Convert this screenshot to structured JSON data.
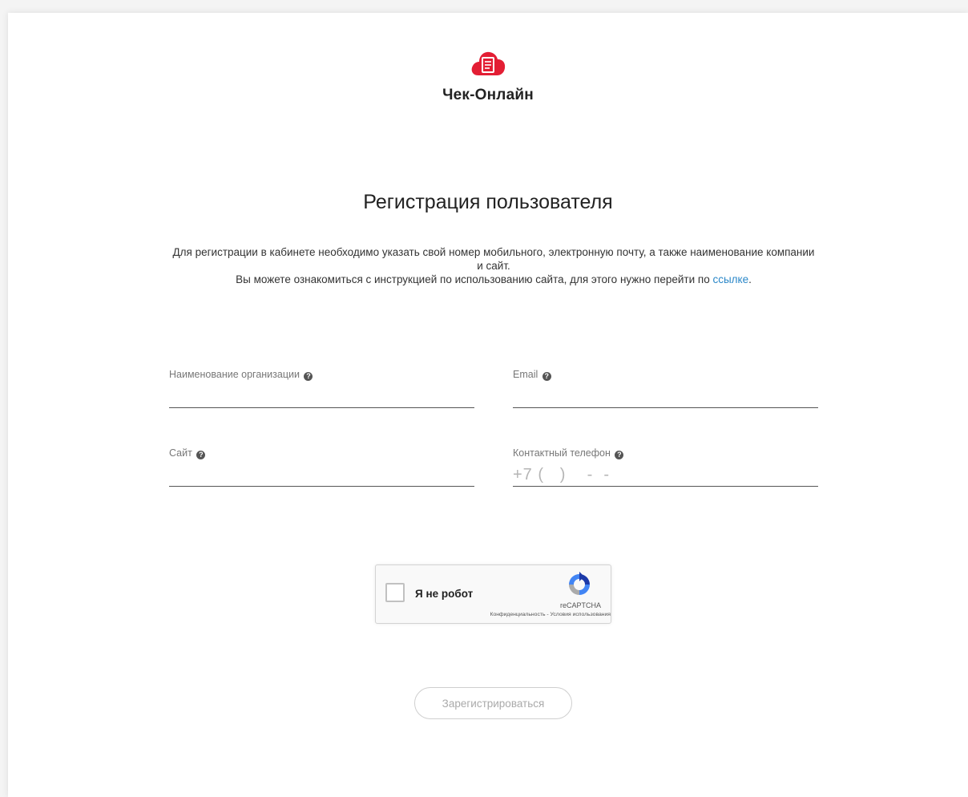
{
  "brand": {
    "name": "Чек-Онлайн",
    "color": "#e31e34"
  },
  "page": {
    "title": "Регистрация пользователя"
  },
  "intro": {
    "line1": "Для регистрации в кабинете необходимо указать свой номер мобильного, электронную почту, а также наименование компании и сайт.",
    "line2_prefix": "Вы можете ознакомиться с инструкцией по использованию сайта, для этого нужно перейти по ",
    "link_text": "ссылке",
    "line2_suffix": ".",
    "link_color": "#2a87c8"
  },
  "form": {
    "organization": {
      "label": "Наименование организации",
      "value": "",
      "placeholder": ""
    },
    "email": {
      "label": "Email",
      "value": "",
      "placeholder": ""
    },
    "site": {
      "label": "Сайт",
      "value": "",
      "placeholder": ""
    },
    "phone": {
      "label": "Контактный телефон",
      "value": "",
      "placeholder": "+7 (   )    -  -"
    },
    "help_icon": "question-circle-icon"
  },
  "captcha": {
    "label": "Я не робот",
    "brand": "reCAPTCHA",
    "privacy_link": "Конфиденциальность",
    "separator": " - ",
    "terms_link": "Условия использования",
    "checked": false
  },
  "actions": {
    "submit_label": "Зарегистрироваться",
    "submit_enabled": false
  }
}
